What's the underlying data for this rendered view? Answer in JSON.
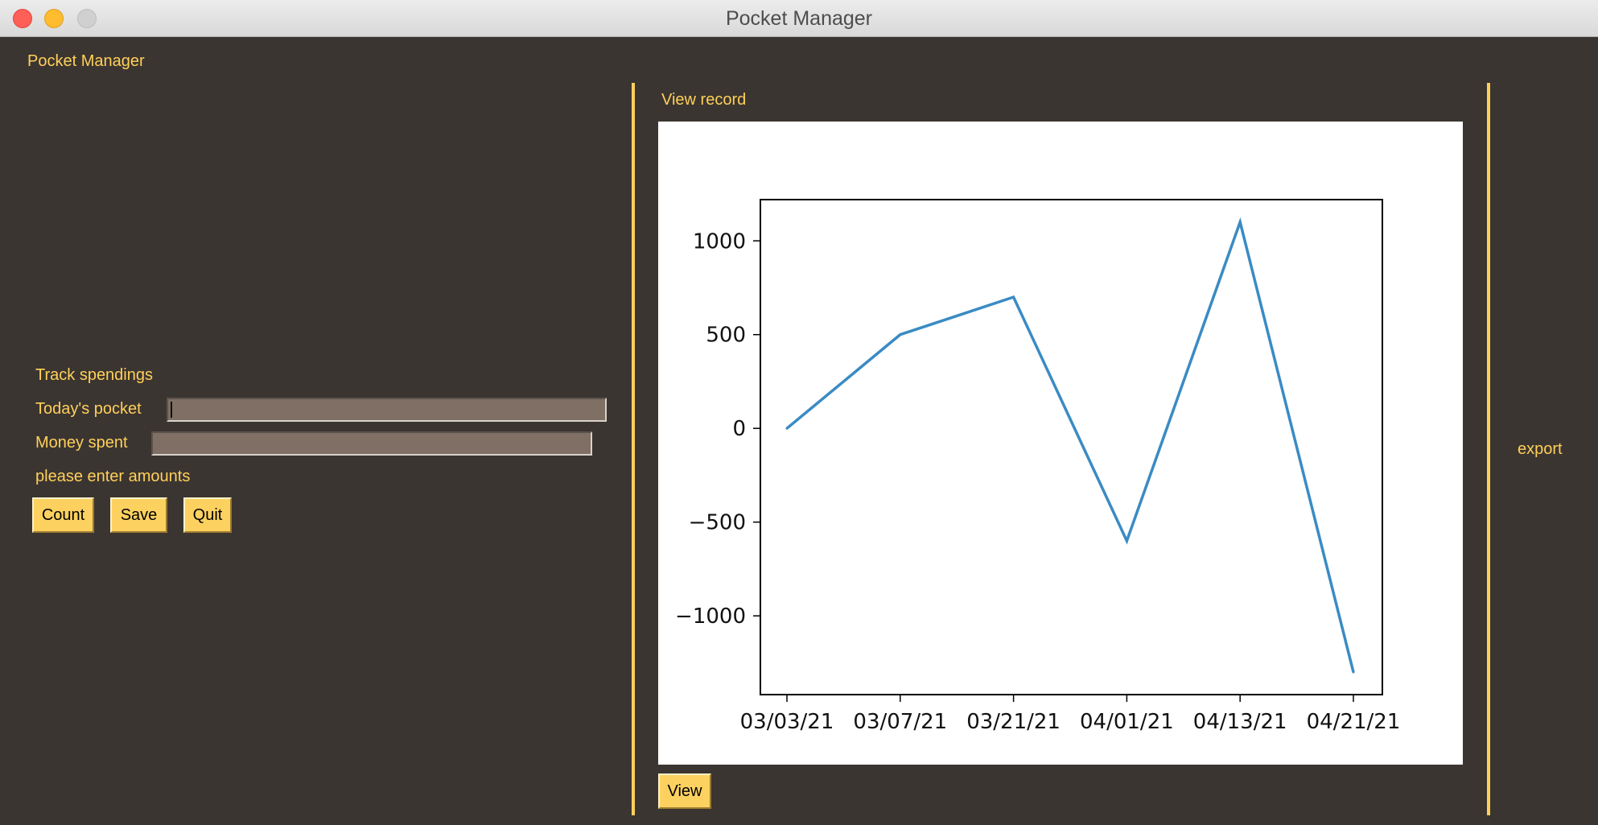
{
  "window": {
    "title": "Pocket Manager",
    "accent_color": "#ffd05a",
    "background_color": "#3b3531"
  },
  "header": {
    "app_label": "Pocket Manager"
  },
  "left_panel": {
    "section_title": "Track spendings",
    "todays_pocket_label": "Today's pocket",
    "todays_pocket_value": "",
    "money_spent_label": "Money spent",
    "money_spent_value": "",
    "status_message": "please enter amounts",
    "buttons": {
      "count": "Count",
      "save": "Save",
      "quit": "Quit"
    }
  },
  "center_panel": {
    "title": "View record",
    "view_button": "View"
  },
  "right_panel": {
    "export_label": "export"
  },
  "chart_data": {
    "type": "line",
    "categories": [
      "03/03/21",
      "03/07/21",
      "03/21/21",
      "04/01/21",
      "04/13/21",
      "04/21/21"
    ],
    "series": [
      {
        "values": [
          0,
          500,
          700,
          -600,
          1100,
          -1300
        ],
        "color": "#3a8bc4"
      }
    ],
    "y_ticks": [
      1000,
      500,
      0,
      -500,
      -1000
    ],
    "y_tick_labels": [
      "1000",
      "500",
      "0",
      "−500",
      "−1000"
    ],
    "ylim": [
      -1420,
      1220
    ],
    "grid": false
  }
}
